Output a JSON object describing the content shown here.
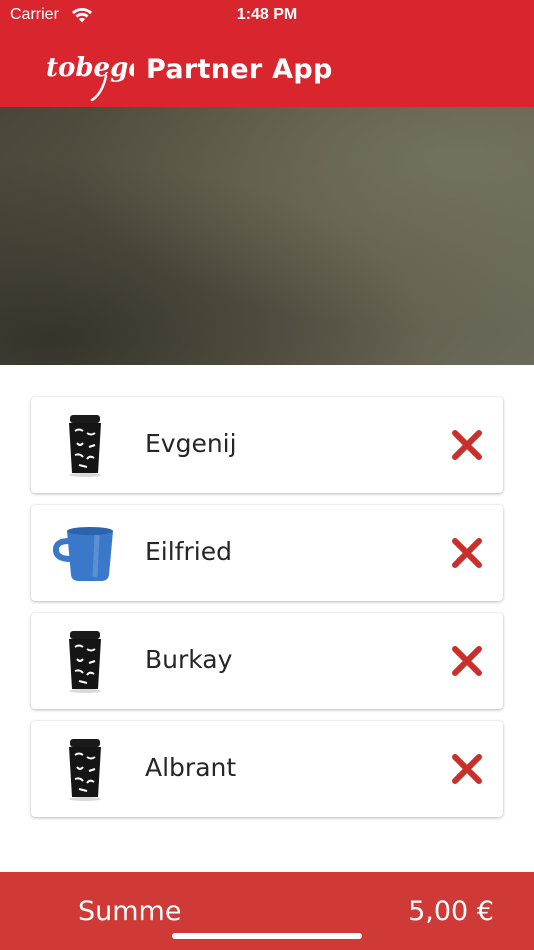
{
  "status_bar": {
    "carrier": "Carrier",
    "time": "1:48 PM"
  },
  "app_bar": {
    "logo_text": "tobego",
    "title": "Partner App",
    "color": "#d9262e"
  },
  "items": [
    {
      "name": "Evgenij",
      "icon": "black-togo-cup-icon"
    },
    {
      "name": "Eilfried",
      "icon": "blue-mug-icon"
    },
    {
      "name": "Burkay",
      "icon": "black-togo-cup-icon"
    },
    {
      "name": "Albrant",
      "icon": "black-togo-cup-icon"
    }
  ],
  "remove_icon_color": "#c9302c",
  "footer": {
    "label": "Summe",
    "total": "5,00 €",
    "color": "#cf3a36"
  }
}
